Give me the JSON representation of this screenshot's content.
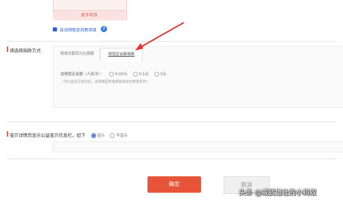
{
  "top": {
    "more_label": "更多项目"
  },
  "auto_subsidy": {
    "label": "自动领取支持新项目",
    "help": "?"
  },
  "donation_method": {
    "title": "请选择捐款方式",
    "tabs": [
      {
        "label": "按成交额百分比捐款",
        "active": false
      },
      {
        "label": "按固定金额捐款",
        "active": true
      }
    ],
    "amount_label": "选择固定金额（人民币）：",
    "options": [
      {
        "label": "0.02元",
        "selected": false
      },
      {
        "label": "0.1元",
        "selected": false
      },
      {
        "label": "1元",
        "selected": false
      }
    ],
    "hint": "（当公益宝贝成交后，会捐赠固定金额给指定的慈善机构）"
  },
  "display_setting": {
    "title": "宝贝详情页显示公益宝贝信息栏，如下",
    "options": [
      {
        "label": "显示",
        "selected": true
      },
      {
        "label": "不显示",
        "selected": false
      }
    ]
  },
  "buttons": {
    "confirm": "确定",
    "cancel": "取消"
  },
  "watermark": "头条 @威武雄壮的小蚂蚁",
  "colors": {
    "accent": "#e8543a",
    "link": "#2b5bd7",
    "arrow": "#e5322d"
  }
}
